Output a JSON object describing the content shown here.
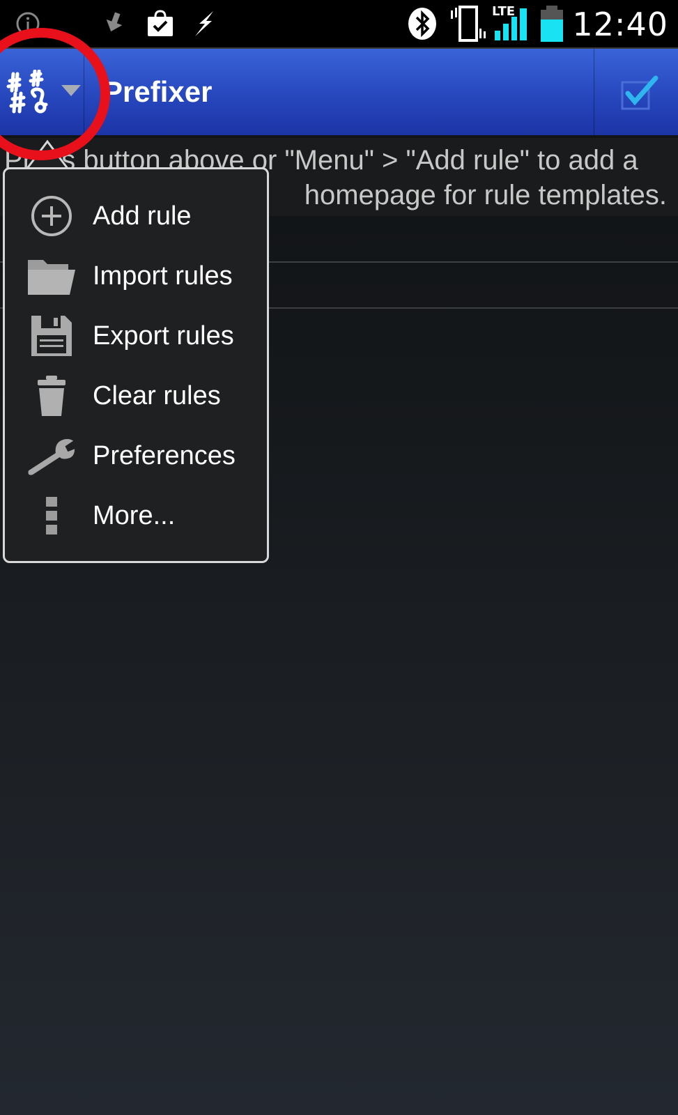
{
  "status_bar": {
    "icons": [
      "info-icon",
      "download-icon",
      "shopping-bag-icon",
      "flash-icon",
      "bluetooth-icon",
      "vibrate-icon",
      "lte-signal-icon",
      "battery-icon"
    ],
    "network_label": "LTE",
    "time": "12:40",
    "battery_color": "#19e3f2"
  },
  "action_bar": {
    "title": "Prefixer",
    "app_icon": "hashtag-app-icon",
    "overflow_icon": "dropdown-triangle-icon",
    "action_icon": "checkbox-icon",
    "accent_color": "#2d4fc6"
  },
  "hint": {
    "line1": "Press button above or \"Menu\" > \"Add rule\" to add a",
    "line2": "homepage for rule templates."
  },
  "menu": {
    "items": [
      {
        "label": "Add rule",
        "icon": "add-circle-icon"
      },
      {
        "label": "Import rules",
        "icon": "folder-icon"
      },
      {
        "label": "Export rules",
        "icon": "save-icon"
      },
      {
        "label": "Clear rules",
        "icon": "trash-icon"
      },
      {
        "label": "Preferences",
        "icon": "wrench-icon"
      },
      {
        "label": "More...",
        "icon": "more-vertical-icon"
      }
    ]
  },
  "annotation_color": "#e8101a"
}
